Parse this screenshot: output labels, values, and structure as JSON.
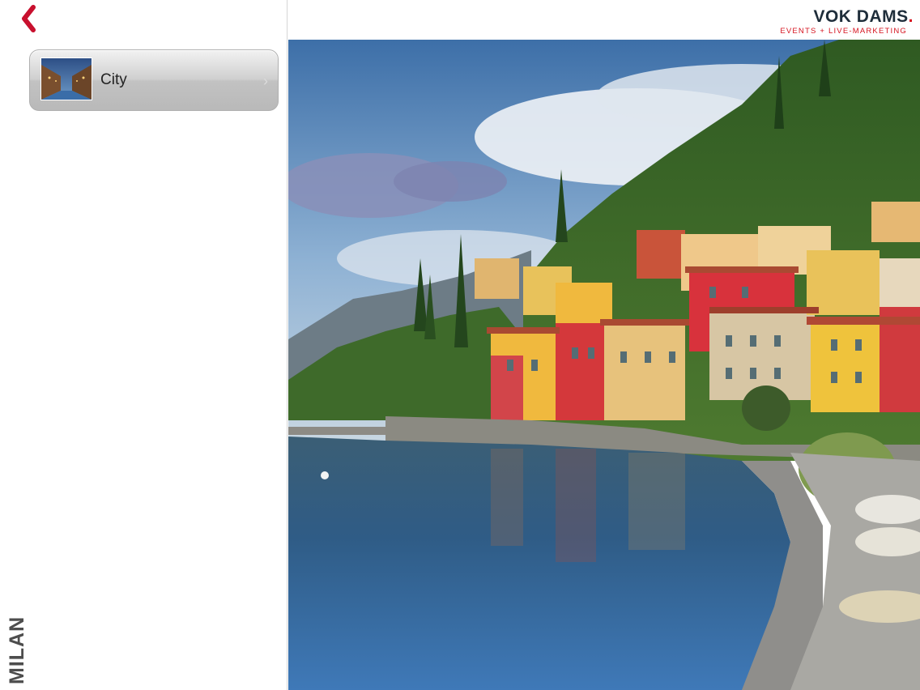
{
  "sidebar": {
    "back_icon": "chevron-left-icon",
    "items": [
      {
        "label": "City",
        "thumbnail": "canal-at-night-image"
      }
    ],
    "vertical_label": "MILAN"
  },
  "header": {
    "logo_main": "VOK DAMS",
    "logo_dot": ".",
    "logo_sub": "EVENTS + LIVE-MARKETING"
  },
  "main": {
    "hero_image": "lakeside-village-photo"
  },
  "colors": {
    "accent": "#d6131f",
    "logo_text": "#1e2d3a",
    "label": "#4d4d4d"
  }
}
